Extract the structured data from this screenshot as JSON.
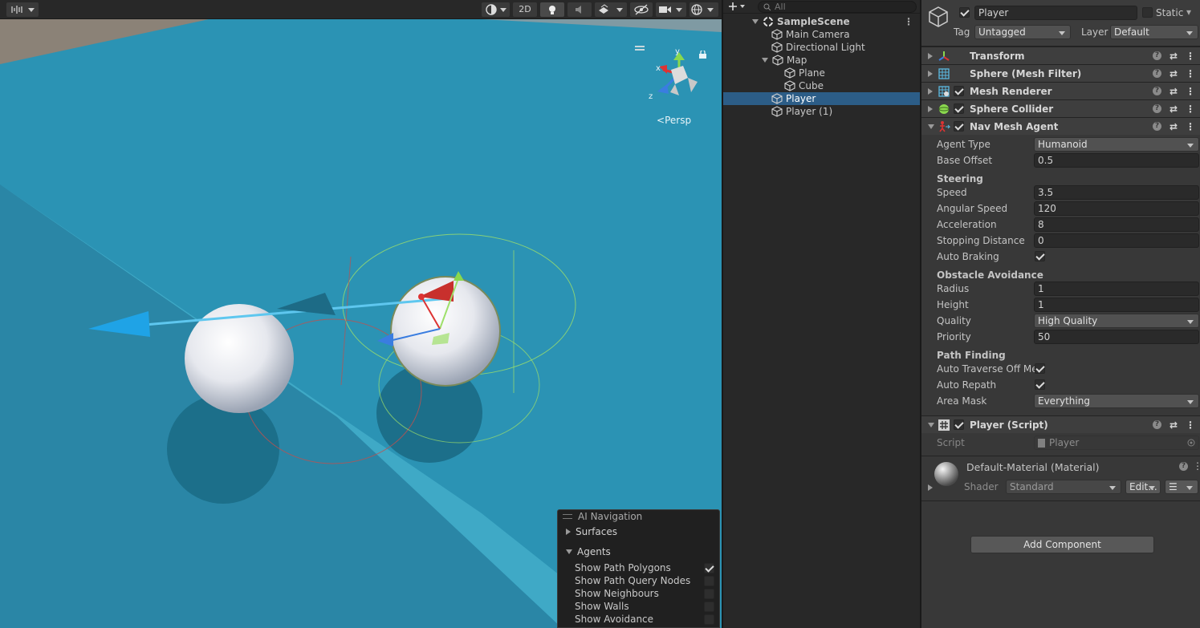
{
  "scene_toolbar": {
    "btn_2d": "2D"
  },
  "scene_view": {
    "projection_label": "Persp",
    "gizmo_axis_y": "y",
    "gizmo_axis_x": "x",
    "gizmo_axis_z": "z"
  },
  "ai_navigation": {
    "title": "AI Navigation",
    "surfaces_label": "Surfaces",
    "agents_label": "Agents",
    "options": [
      {
        "label": "Show Path Polygons",
        "checked": true
      },
      {
        "label": "Show Path Query Nodes",
        "checked": false
      },
      {
        "label": "Show Neighbours",
        "checked": false
      },
      {
        "label": "Show Walls",
        "checked": false
      },
      {
        "label": "Show Avoidance",
        "checked": false
      }
    ]
  },
  "hierarchy": {
    "search_placeholder": "All",
    "scene_name": "SampleScene",
    "items": [
      {
        "label": "Main Camera"
      },
      {
        "label": "Directional Light"
      },
      {
        "label": "Map"
      },
      {
        "label": "Plane"
      },
      {
        "label": "Cube"
      },
      {
        "label": "Player"
      },
      {
        "label": "Player (1)"
      }
    ]
  },
  "inspector": {
    "object_name": "Player",
    "static_label": "Static",
    "tag_label": "Tag",
    "tag_value": "Untagged",
    "layer_label": "Layer",
    "layer_value": "Default",
    "components": {
      "transform": "Transform",
      "mesh_filter": "Sphere (Mesh Filter)",
      "mesh_renderer": "Mesh Renderer",
      "sphere_collider": "Sphere Collider",
      "nav_mesh_agent": "Nav Mesh Agent",
      "player_script": "Player (Script)"
    },
    "nav": {
      "agent_type_label": "Agent Type",
      "agent_type_value": "Humanoid",
      "base_offset_label": "Base Offset",
      "base_offset_value": "0.5",
      "steering_header": "Steering",
      "speed_label": "Speed",
      "speed_value": "3.5",
      "angular_speed_label": "Angular Speed",
      "angular_speed_value": "120",
      "acceleration_label": "Acceleration",
      "acceleration_value": "8",
      "stopping_distance_label": "Stopping Distance",
      "stopping_distance_value": "0",
      "auto_braking_label": "Auto Braking",
      "obstacle_header": "Obstacle Avoidance",
      "radius_label": "Radius",
      "radius_value": "1",
      "height_label": "Height",
      "height_value": "1",
      "quality_label": "Quality",
      "quality_value": "High Quality",
      "priority_label": "Priority",
      "priority_value": "50",
      "path_header": "Path Finding",
      "auto_traverse_label": "Auto Traverse Off Me",
      "auto_repath_label": "Auto Repath",
      "area_mask_label": "Area Mask",
      "area_mask_value": "Everything"
    },
    "script": {
      "script_label": "Script",
      "script_value": "Player"
    },
    "material": {
      "name": "Default-Material (Material)",
      "shader_label": "Shader",
      "shader_value": "Standard",
      "edit_label": "Edit..."
    },
    "add_component": "Add Component"
  },
  "colors": {
    "selection": "#2c5d87",
    "water": "#2b8fb0",
    "panel": "#383838"
  }
}
